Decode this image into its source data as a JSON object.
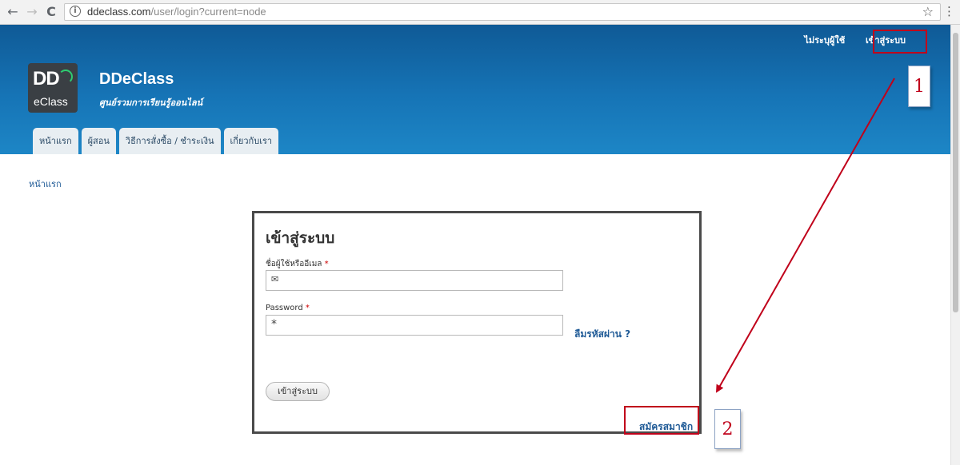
{
  "browser": {
    "back": "←",
    "forward": "→",
    "reload": "C",
    "info": "i",
    "url_host": "ddeclass.com",
    "url_path": "/user/login?current=node",
    "star": "☆",
    "menu": "⋮"
  },
  "header": {
    "top_links": [
      "ไม่ระบุผู้ใช้",
      "เข้าสู่ระบบ"
    ],
    "logo_dd": "DD",
    "logo_eclass": "eClass",
    "site_name": "DDeClass",
    "slogan": "ศูนย์รวมการเรียนรู้ออนไลน์",
    "tabs": [
      "หน้าแรก",
      "ผู้สอน",
      "วิธีการสั่งซื้อ / ชำระเงิน",
      "เกี่ยวกับเรา"
    ]
  },
  "breadcrumb": "หน้าแรก",
  "login": {
    "title": "เข้าสู่ระบบ",
    "username_label": "ชื่อผู้ใช้หรืออีเมล",
    "password_label": "Password",
    "required_mark": "*",
    "username_icon": "✉",
    "password_icon": "*",
    "forgot": "ลืมรหัสผ่าน ?",
    "submit": "เข้าสู่ระบบ",
    "register": "สมัครสมาชิก"
  },
  "annotations": {
    "step1": "1",
    "step2": "2",
    "color": "#c0001a"
  }
}
